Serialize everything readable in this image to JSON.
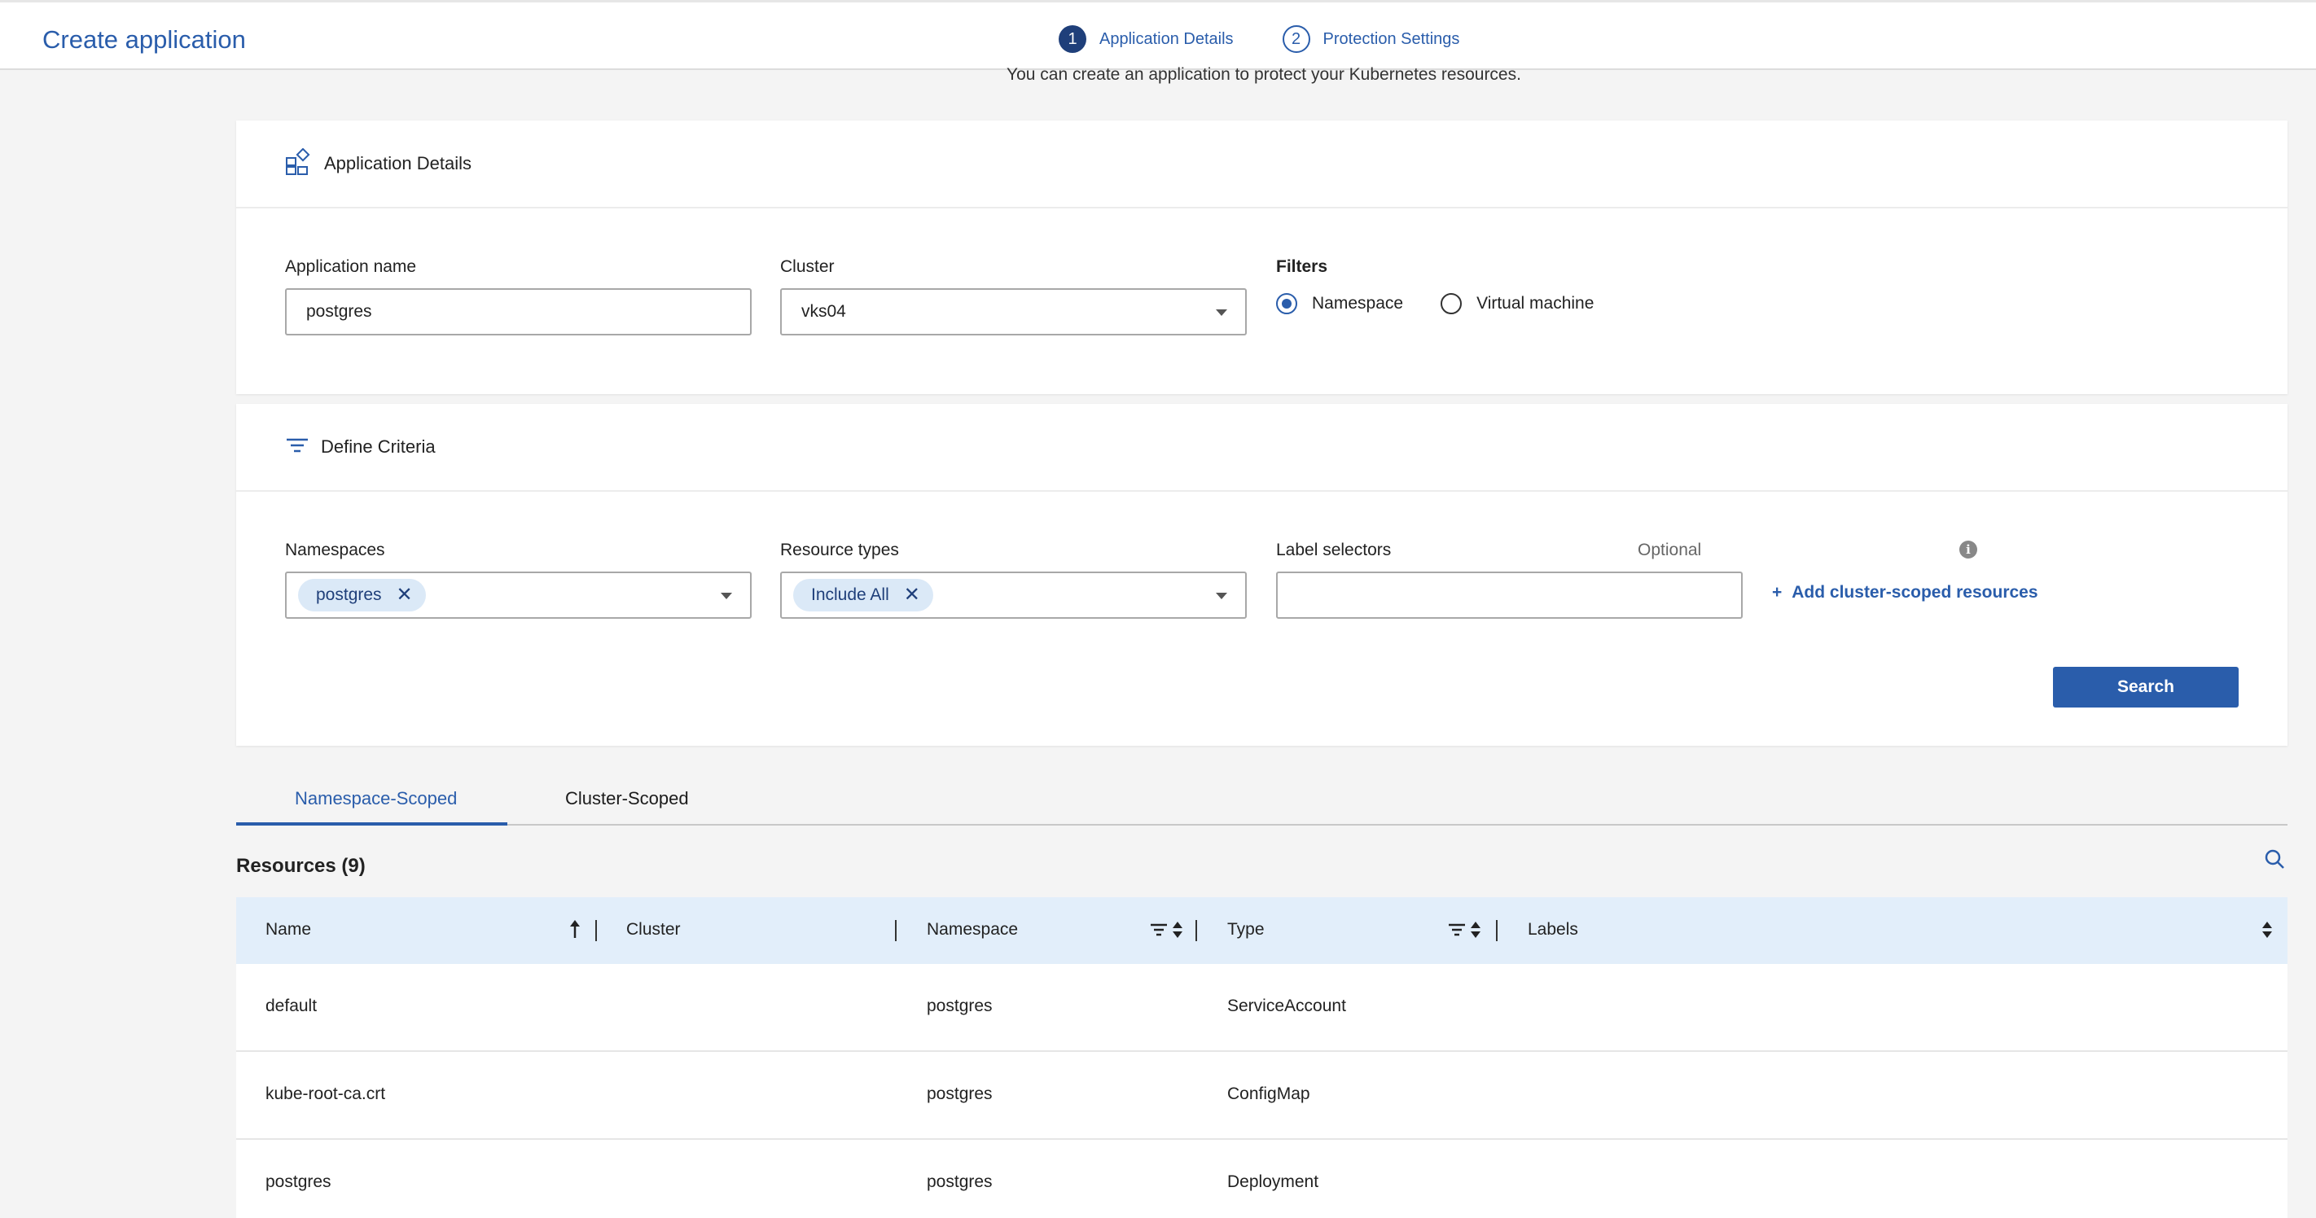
{
  "header": {
    "title": "Create application",
    "steps": [
      {
        "number": "1",
        "label": "Application Details"
      },
      {
        "number": "2",
        "label": "Protection Settings"
      }
    ]
  },
  "subtitle": "You can create an application to protect your Kubernetes resources.",
  "app_details": {
    "title": "Application Details",
    "name_label": "Application name",
    "name_value": "postgres",
    "cluster_label": "Cluster",
    "cluster_value": "vks04",
    "filters_label": "Filters",
    "filter_options": [
      "Namespace",
      "Virtual machine"
    ],
    "filter_selected": "Namespace"
  },
  "criteria": {
    "title": "Define Criteria",
    "namespaces_label": "Namespaces",
    "namespaces_chip": "postgres",
    "resource_types_label": "Resource types",
    "resource_types_chip": "Include All",
    "label_selectors_label": "Label selectors",
    "optional_text": "Optional",
    "label_selectors_value": "",
    "add_link": "Add cluster-scoped resources",
    "search_button": "Search"
  },
  "tabs": [
    "Namespace-Scoped",
    "Cluster-Scoped"
  ],
  "resources": {
    "title": "Resources (9)",
    "columns": [
      "Name",
      "Cluster",
      "Namespace",
      "Type",
      "Labels"
    ],
    "rows": [
      {
        "name": "default",
        "cluster": "",
        "namespace": "postgres",
        "type": "ServiceAccount",
        "labels": ""
      },
      {
        "name": "kube-root-ca.crt",
        "cluster": "",
        "namespace": "postgres",
        "type": "ConfigMap",
        "labels": ""
      },
      {
        "name": "postgres",
        "cluster": "",
        "namespace": "postgres",
        "type": "Deployment",
        "labels": ""
      }
    ]
  },
  "colors": {
    "accent": "#2a5dab",
    "accent_dark": "#1f3f7a",
    "table_header_bg": "#e2eefa",
    "chip_bg": "#dbe9f7"
  }
}
